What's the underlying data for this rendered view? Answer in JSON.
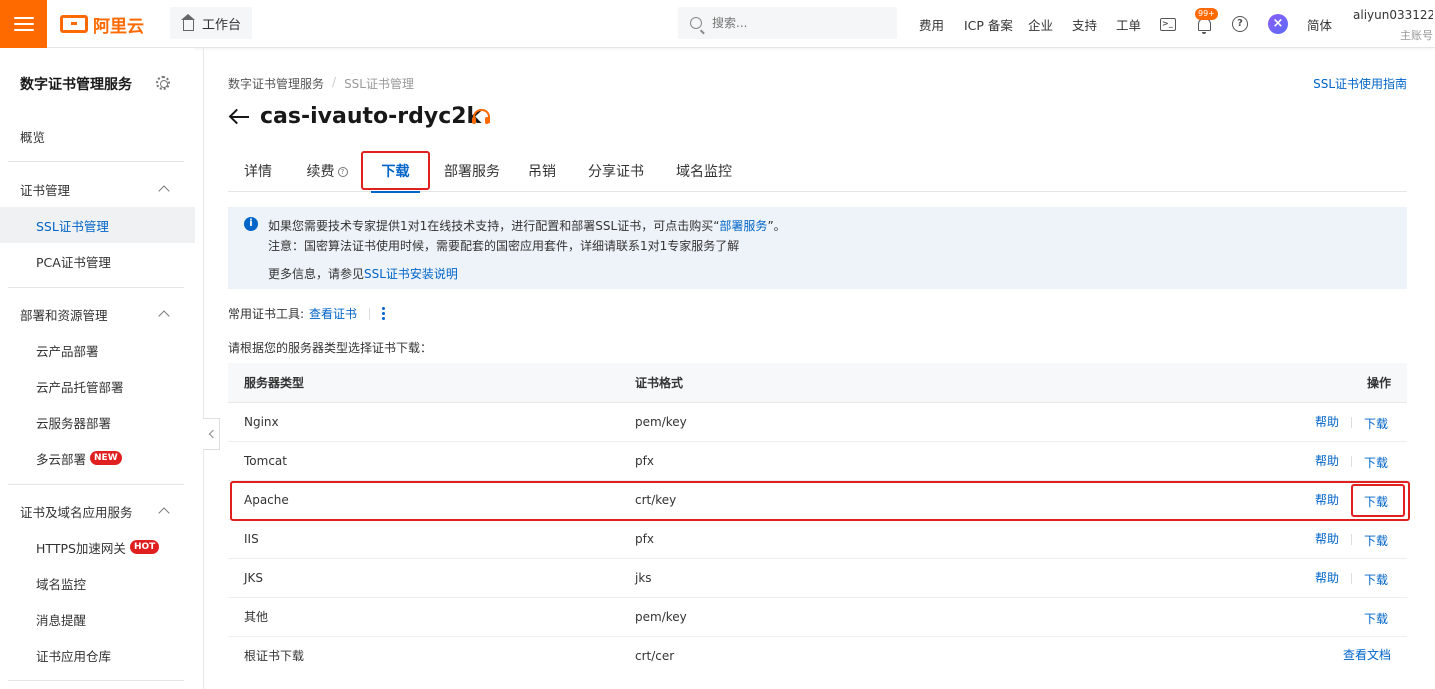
{
  "topbar": {
    "logo_text": "阿里云",
    "workbench": "工作台",
    "search_placeholder": "搜索...",
    "nav": [
      "费用",
      "ICP 备案",
      "企业",
      "支持",
      "工单"
    ],
    "notification_count": "99+",
    "language": "简体",
    "account_name": "aliyun033122...",
    "account_type": "主账号",
    "accent_color": "#ff6a00"
  },
  "sidebar": {
    "title": "数字证书管理服务",
    "overview": "概览",
    "groups": [
      {
        "label": "证书管理",
        "items": [
          "SSL证书管理",
          "PCA证书管理"
        ]
      },
      {
        "label": "部署和资源管理",
        "items": [
          "云产品部署",
          "云产品托管部署",
          "云服务器部署",
          "多云部署"
        ]
      },
      {
        "label": "证书及域名应用服务",
        "items": [
          "HTTPS加速网关",
          "域名监控",
          "消息提醒",
          "证书应用仓库"
        ]
      }
    ],
    "active_item": "SSL证书管理",
    "tag_new": "NEW",
    "tag_hot": "HOT"
  },
  "breadcrumb": [
    "数字证书管理服务",
    "/",
    "SSL证书管理"
  ],
  "guide_link": "SSL证书使用指南",
  "page_title": "cas-ivauto-rdyc2k",
  "tabs": [
    "详情",
    "续费",
    "下载",
    "部署服务",
    "吊销",
    "分享证书",
    "域名监控"
  ],
  "active_tab": "下载",
  "notice": {
    "line1_prefix": "如果您需要技术专家提供1对1在线技术支持，进行配置和部署SSL证书，可点击购买“",
    "line1_link": "部署服务",
    "line1_suffix": "”。",
    "line2": "注意：国密算法证书使用时候，需要配套的国密应用套件，详细请联系1对1专家服务了解",
    "line3_prefix": "更多信息，请参见",
    "line3_link": "SSL证书安装说明"
  },
  "tools": {
    "label": "常用证书工具:",
    "link": "查看证书"
  },
  "choose_text": "请根据您的服务器类型选择证书下载：",
  "table": {
    "headers": [
      "服务器类型",
      "证书格式",
      "操作"
    ],
    "help_label": "帮助",
    "download_label": "下载",
    "rows": [
      {
        "server": "Nginx",
        "format": "pem/key",
        "help": true,
        "action": "下载"
      },
      {
        "server": "Tomcat",
        "format": "pfx",
        "help": true,
        "action": "下载"
      },
      {
        "server": "Apache",
        "format": "crt/key",
        "help": true,
        "action": "下载"
      },
      {
        "server": "IIS",
        "format": "pfx",
        "help": true,
        "action": "下载"
      },
      {
        "server": "JKS",
        "format": "jks",
        "help": true,
        "action": "下载"
      },
      {
        "server": "其他",
        "format": "pem/key",
        "help": false,
        "action": "下载"
      },
      {
        "server": "根证书下载",
        "format": "crt/cer",
        "help": false,
        "action": "查看文档"
      }
    ]
  },
  "highlight_color": "#e0201f",
  "link_color": "#0064c8"
}
